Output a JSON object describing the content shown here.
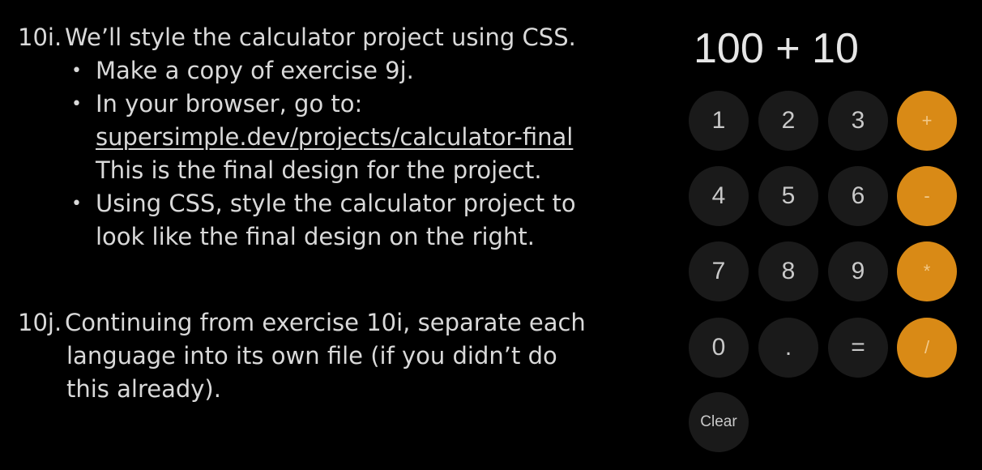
{
  "exercise_10i": {
    "number": "10i.",
    "title": "We’ll style the calculator project using CSS.",
    "bullet_1": "Make a copy of exercise 9j.",
    "bullet_2": "In your browser, go to:",
    "link": "supersimple.dev/projects/calculator-final",
    "bullet_2_cont": "This is the final design for the project.",
    "bullet_3": "Using CSS, style the calculator project to",
    "bullet_3_cont": "look like the final design on the right."
  },
  "exercise_10j": {
    "number": "10j.",
    "line_1": "Continuing from exercise 10i, separate each",
    "line_2": "language into its own file (if you didn’t do",
    "line_3": "this already)."
  },
  "calculator": {
    "display": "100 + 10",
    "keys": {
      "k1": "1",
      "k2": "2",
      "k3": "3",
      "plus": "+",
      "k4": "4",
      "k5": "5",
      "k6": "6",
      "minus": "-",
      "k7": "7",
      "k8": "8",
      "k9": "9",
      "multiply": "*",
      "k0": "0",
      "dot": ".",
      "equals": "=",
      "divide": "/",
      "clear": "Clear"
    },
    "colors": {
      "background": "#000000",
      "number_key": "#1a1a1a",
      "operator_key": "#d98a16"
    }
  }
}
